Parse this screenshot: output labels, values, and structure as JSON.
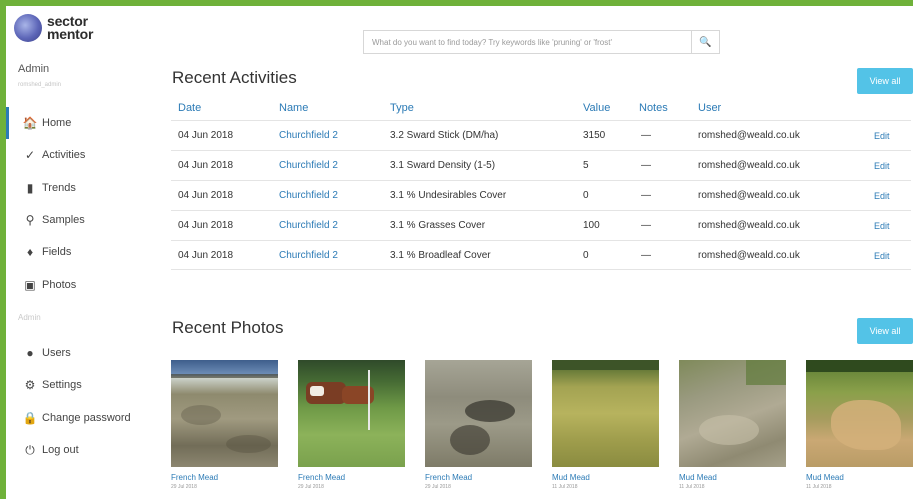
{
  "brand": {
    "line1": "sector",
    "line2": "mentor"
  },
  "user": {
    "name": "Admin",
    "sub": "romshed_admin"
  },
  "nav": [
    {
      "label": "Home",
      "icon": "home-icon",
      "glyph": "🏠",
      "active": true
    },
    {
      "label": "Activities",
      "icon": "check-icon",
      "glyph": "✓"
    },
    {
      "label": "Trends",
      "icon": "bar-chart-icon",
      "glyph": "▮"
    },
    {
      "label": "Samples",
      "icon": "location-pin-icon",
      "glyph": "⚲"
    },
    {
      "label": "Fields",
      "icon": "pin-icon",
      "glyph": "♦"
    },
    {
      "label": "Photos",
      "icon": "image-icon",
      "glyph": "▣"
    }
  ],
  "nav_section": "Admin",
  "nav_admin": [
    {
      "label": "Users",
      "icon": "user-icon",
      "glyph": "●"
    },
    {
      "label": "Settings",
      "icon": "gear-icon",
      "glyph": "⚙"
    },
    {
      "label": "Change password",
      "icon": "lock-icon",
      "glyph": "🔒"
    },
    {
      "label": "Log out",
      "icon": "power-icon",
      "glyph": "⏻"
    }
  ],
  "search": {
    "placeholder": "What do you want to find today? Try keywords like 'pruning' or 'frost'",
    "button_glyph": "🔍"
  },
  "activities": {
    "title": "Recent Activities",
    "view_all": "View all",
    "columns": [
      "Date",
      "Name",
      "Type",
      "Value",
      "Notes",
      "User"
    ],
    "rows": [
      {
        "date": "04 Jun 2018",
        "name": "Churchfield 2",
        "type": "3.2 Sward Stick (DM/ha)",
        "value": "3150",
        "notes": "—",
        "user": "romshed@weald.co.uk",
        "edit": "Edit"
      },
      {
        "date": "04 Jun 2018",
        "name": "Churchfield 2",
        "type": "3.1 Sward Density (1-5)",
        "value": "5",
        "notes": "—",
        "user": "romshed@weald.co.uk",
        "edit": "Edit"
      },
      {
        "date": "04 Jun 2018",
        "name": "Churchfield 2",
        "type": "3.1 % Undesirables Cover",
        "value": "0",
        "notes": "—",
        "user": "romshed@weald.co.uk",
        "edit": "Edit"
      },
      {
        "date": "04 Jun 2018",
        "name": "Churchfield 2",
        "type": "3.1 % Grasses Cover",
        "value": "100",
        "notes": "—",
        "user": "romshed@weald.co.uk",
        "edit": "Edit"
      },
      {
        "date": "04 Jun 2018",
        "name": "Churchfield 2",
        "type": "3.1 % Broadleaf Cover",
        "value": "0",
        "notes": "—",
        "user": "romshed@weald.co.uk",
        "edit": "Edit"
      }
    ]
  },
  "photos": {
    "title": "Recent Photos",
    "view_all": "View all",
    "items": [
      {
        "name": "French Mead",
        "date": "29 Jul 2018"
      },
      {
        "name": "French Mead",
        "date": "29 Jul 2018"
      },
      {
        "name": "French Mead",
        "date": "29 Jul 2018"
      },
      {
        "name": "Mud Mead",
        "date": "11 Jul 2018"
      },
      {
        "name": "Mud Mead",
        "date": "11 Jul 2018"
      },
      {
        "name": "Mud Mead",
        "date": "11 Jul 2018"
      }
    ]
  },
  "colors": {
    "frame": "#6fb13a",
    "accent": "#2c7bb6",
    "button": "#53c3e7"
  }
}
